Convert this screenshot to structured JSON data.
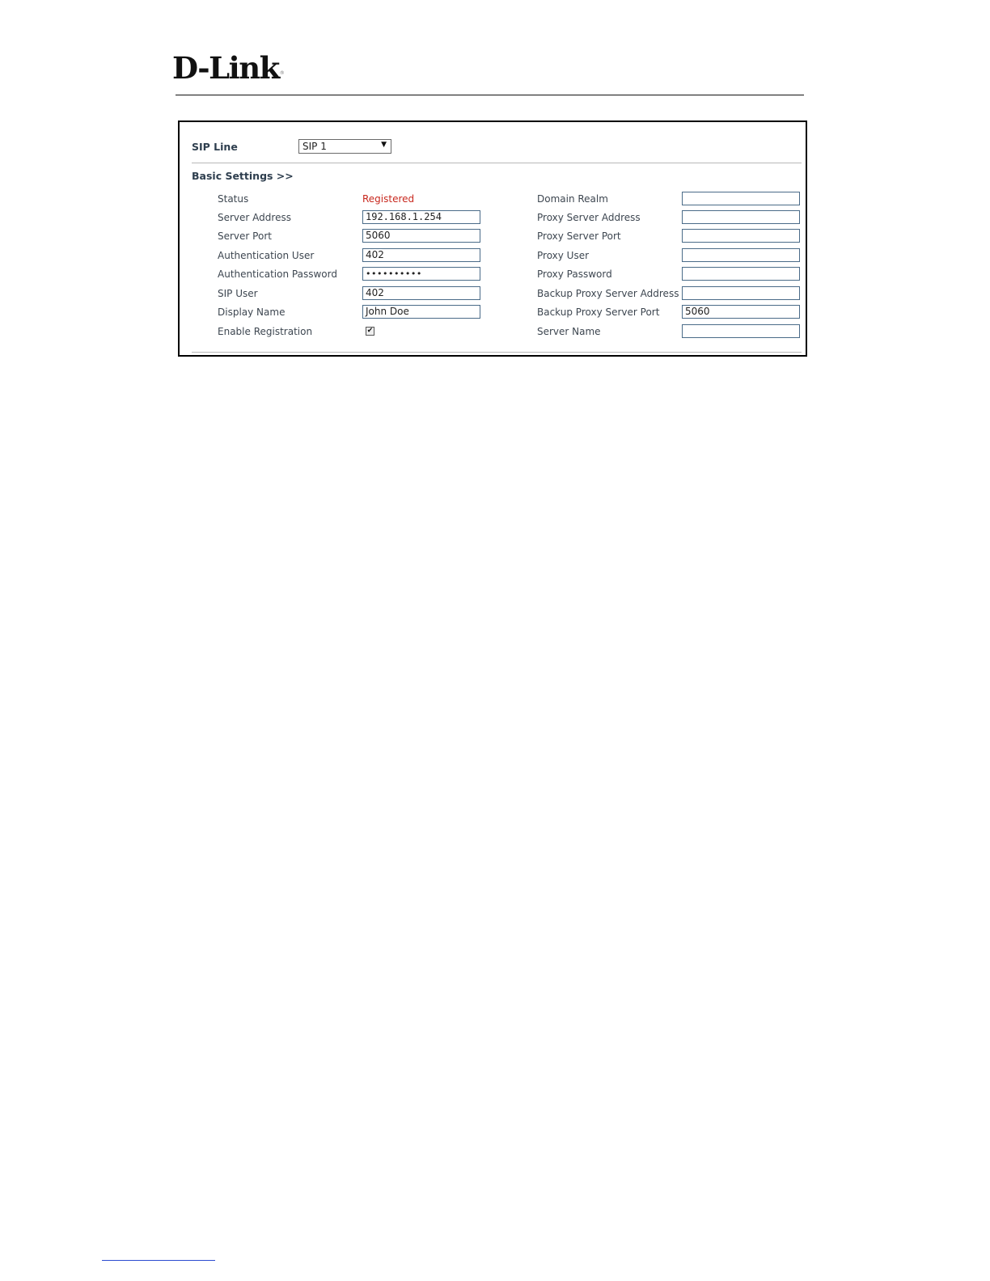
{
  "header": {
    "logo_text": "D-Link",
    "logo_mark": "®"
  },
  "sip_line": {
    "label": "SIP Line",
    "selected": "SIP 1"
  },
  "basic_settings": {
    "title": "Basic Settings >>",
    "left": [
      {
        "label": "Status",
        "value": "Registered",
        "kind": "status"
      },
      {
        "label": "Server Address",
        "value": "192.168.1.254",
        "kind": "input"
      },
      {
        "label": "Server Port",
        "value": "5060",
        "kind": "input"
      },
      {
        "label": "Authentication User",
        "value": "402",
        "kind": "input"
      },
      {
        "label": "Authentication Password",
        "value": "••••••••••",
        "kind": "password"
      },
      {
        "label": "SIP User",
        "value": "402",
        "kind": "input"
      },
      {
        "label": "Display Name",
        "value": "John Doe",
        "kind": "input"
      },
      {
        "label": "Enable Registration",
        "value": "✔",
        "kind": "checkbox"
      }
    ],
    "right": [
      {
        "label": "Domain Realm",
        "value": ""
      },
      {
        "label": "Proxy Server Address",
        "value": ""
      },
      {
        "label": "Proxy Server Port",
        "value": ""
      },
      {
        "label": "Proxy User",
        "value": ""
      },
      {
        "label": "Proxy Password",
        "value": ""
      },
      {
        "label": "Backup Proxy Server Address",
        "value": ""
      },
      {
        "label": "Backup Proxy Server Port",
        "value": "5060"
      },
      {
        "label": "Server Name",
        "value": ""
      }
    ]
  },
  "colors": {
    "status_registered": "#c8281e",
    "label_text": "#3d4650",
    "input_border": "#4a6b88"
  }
}
